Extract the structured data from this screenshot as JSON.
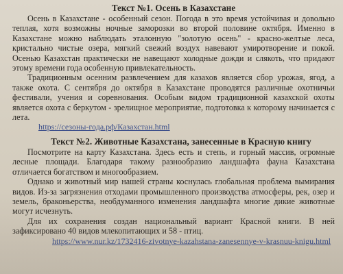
{
  "section1": {
    "title": "Текст №1. Осень в Казахстане",
    "p1": "Осень в Казахстане - особенный сезон. Погода в это время устойчивая и довольно теплая, хотя возможны ночные заморозки во второй половине октября. Именно в Казахстане можно наблюдать эталонную \"золотую осень\" - красно-желтые леса, кристально чистые озера, мягкий свежий воздух навевают умиротворение и покой. Осенью Казахстан практически не навещают холодные дожди и слякоть, что придают этому времени года особенную привлекательность.",
    "p2": "Традиционным осенним развлечением для казахов является сбор урожая, ягод, а также охота. С сентября до октября в Казахстане проводятся различные охотничьи фестивали, учения и соревнования. Особым видом традиционной казахской охоты является охота с беркутом - зрелищное мероприятие, подготовка к которому начинается с лета.",
    "link": "https://сезоны-года.рф/Казахстан.html"
  },
  "section2": {
    "title": "Текст №2. Животные Казахстана, занесенные в Красную книгу",
    "p1": "Посмотрите на карту Казахстана. Здесь есть и степь, и горный массив, огромные лесные площади. Благодаря такому разнообразию ландшафта фауна Казахстана отличается богатством и многообразием.",
    "p2": "Однако и животный мир нашей страны коснулась глобальная проблема вымирания видов. Из-за загрязнения отходами промышленного производства атмосферы, рек, озер и земель, браконьерства, необдуманного изменения ландшафта многие дикие животные могут исчезнуть.",
    "p3": "Для их сохранения создан национальный вариант Красной книги. В ней зафиксировано 40 видов млекопитающих и 58 - птиц.",
    "link": "https://www.nur.kz/1732416-zivotnye-kazahstana-zanesennye-v-krasnuu-knigu.html"
  }
}
